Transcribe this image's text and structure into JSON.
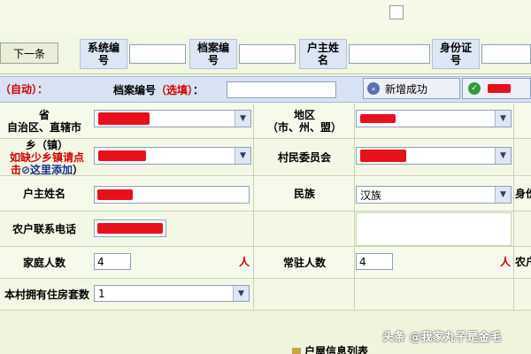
{
  "toolbar": {
    "next_button": "下一条"
  },
  "search": {
    "system_no_label": "系统编号",
    "archive_no_label": "档案编号",
    "head_name_label": "户主姓名",
    "id_no_label": "身份证号"
  },
  "band": {
    "auto_label": "（自动）：",
    "archive_no_label": "档案编号",
    "archive_no_hint": "（选填）",
    "archive_no_colon": "：",
    "add_success": "新增成功"
  },
  "form": {
    "province_label_1": "省",
    "province_label_2": "自治区、直辖市",
    "region_label_1": "地区",
    "region_label_2": "（市、州、盟）",
    "town_label": "乡（镇）",
    "town_missing": "如缺少乡镇请点",
    "town_add_prefix": "击",
    "town_add_link": "这里添加",
    "town_add_suffix": "）",
    "village_label": "村民委员会",
    "head_name_label": "户主姓名",
    "ethnic_label": "民族",
    "ethnic_value": "汉族",
    "id_label_partial": "身份",
    "phone_label": "农户联系电话",
    "family_count_label": "家庭人数",
    "family_count_value": "4",
    "family_count_unit": "人",
    "resident_count_label": "常驻人数",
    "resident_count_value": "4",
    "resident_count_unit": "人",
    "farm_label_partial": "农户",
    "houses_label": "本村拥有住房套数",
    "houses_value": "1",
    "bottom_partial": "户屋信息列表"
  },
  "watermark": "头条 @我家丸子是金毛",
  "colors": {
    "redaction": "#e8101c",
    "label_required": "#d00000",
    "band": "#d7e2f4"
  }
}
